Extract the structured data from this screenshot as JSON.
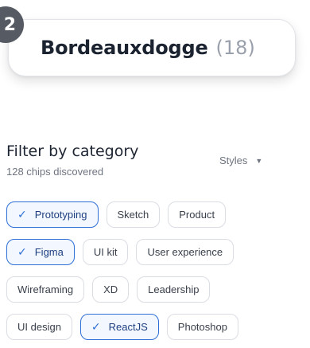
{
  "step_badge": "2",
  "tooltip": {
    "name": "Bordeauxdogge",
    "count": "(18)"
  },
  "filter": {
    "title": "Filter by category",
    "subtitle": "128 chips discovered",
    "dropdown_label": "Styles"
  },
  "chip_rows": [
    [
      {
        "label": "Prototyping",
        "selected": true
      },
      {
        "label": "Sketch",
        "selected": false
      },
      {
        "label": "Product",
        "selected": false
      }
    ],
    [
      {
        "label": "Figma",
        "selected": true
      },
      {
        "label": "UI kit",
        "selected": false
      },
      {
        "label": "User experience",
        "selected": false
      }
    ],
    [
      {
        "label": "Wireframing",
        "selected": false
      },
      {
        "label": "XD",
        "selected": false
      },
      {
        "label": "Leadership",
        "selected": false
      }
    ],
    [
      {
        "label": "UI design",
        "selected": false
      },
      {
        "label": "ReactJS",
        "selected": true
      },
      {
        "label": "Photoshop",
        "selected": false
      }
    ]
  ],
  "colors": {
    "accent": "#2e6fd6",
    "badge": "#555a63"
  },
  "icons": {
    "selected_check": "check-icon",
    "dropdown": "caret-down-icon"
  }
}
